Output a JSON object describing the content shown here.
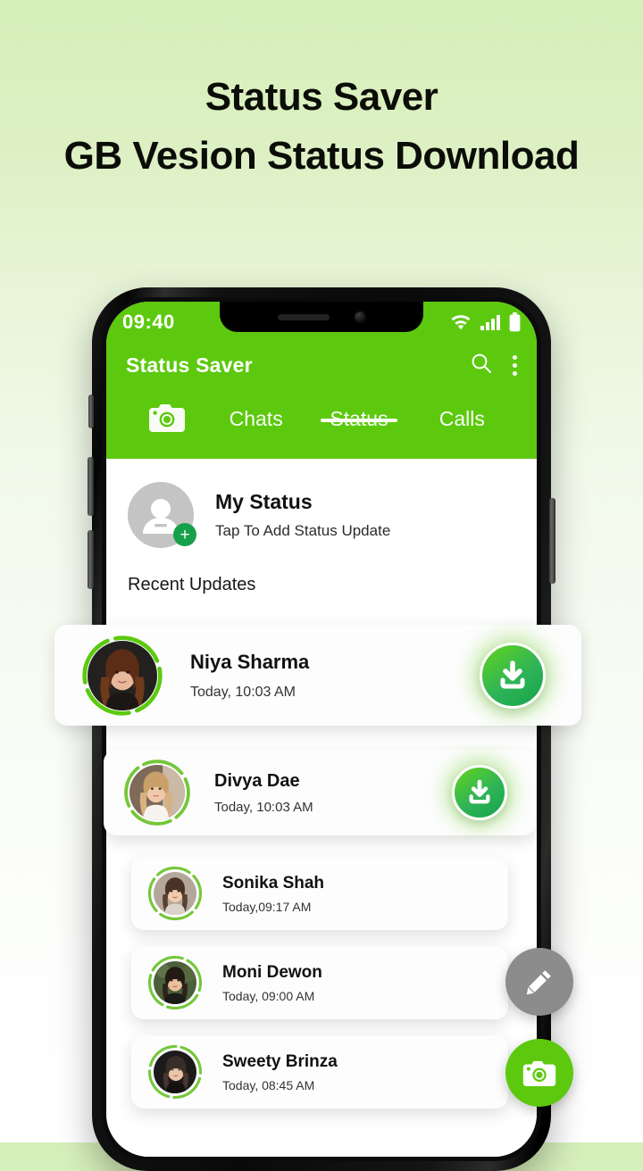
{
  "headline": {
    "line1": "Status Saver",
    "line2": "GB Vesion Status Download"
  },
  "theme": {
    "brand_green": "#5cc90e",
    "badge_green": "#17a04a",
    "background_top": "#d6efba",
    "background_bottom": "#ffffff",
    "fab_gray": "#8c8c8c"
  },
  "phone": {
    "statusbar": {
      "time": "09:40",
      "icons": [
        "wifi-icon",
        "cellular-signal-icon",
        "battery-icon"
      ]
    },
    "appbar": {
      "title": "Status Saver",
      "search_icon": "search-icon",
      "overflow_icon": "overflow-menu-icon"
    },
    "tabs": {
      "camera_icon": "camera-icon",
      "items": [
        {
          "label": "Chats",
          "active": false
        },
        {
          "label": "Status",
          "active": true
        },
        {
          "label": "Calls",
          "active": false
        }
      ]
    },
    "my_status": {
      "title": "My Status",
      "subtitle": "Tap To Add Status Update",
      "add_badge": "+",
      "avatar_icon": "person-placeholder-icon"
    },
    "section_header": "Recent Updates",
    "status_list": [
      {
        "name": "Niya Sharma",
        "time": "Today, 10:03 AM",
        "has_download": true
      },
      {
        "name": "Divya Dae",
        "time": "Today, 10:03 AM",
        "has_download": true
      },
      {
        "name": "Sonika Shah",
        "time": "Today,09:17 AM",
        "has_download": false
      },
      {
        "name": "Moni Dewon",
        "time": "Today, 09:00 AM",
        "has_download": false
      },
      {
        "name": "Sweety Brinza",
        "time": "Today, 08:45 AM",
        "has_download": false
      }
    ],
    "fabs": [
      {
        "name": "edit-fab",
        "icon": "pencil-icon",
        "color": "#8c8c8c"
      },
      {
        "name": "camera-fab",
        "icon": "camera-icon",
        "color": "#5cc90e"
      }
    ]
  }
}
